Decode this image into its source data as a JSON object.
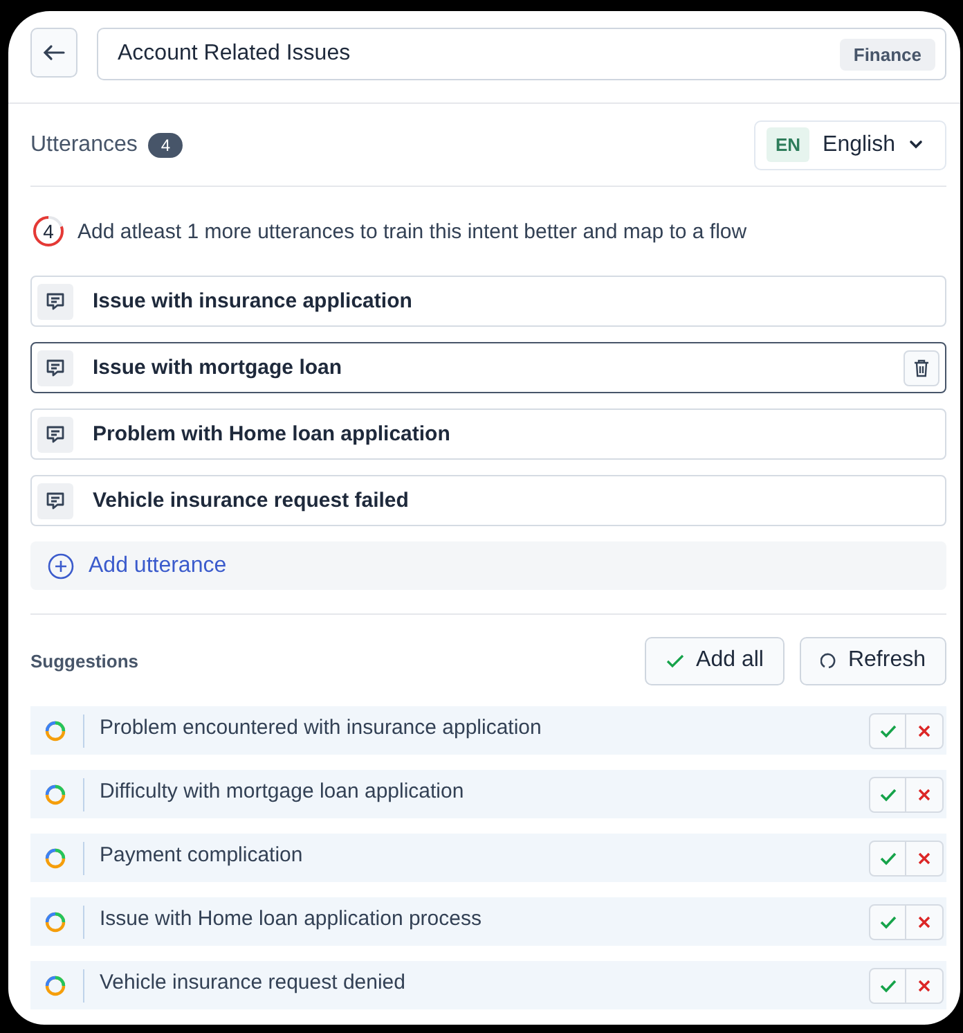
{
  "header": {
    "title": "Account Related Issues",
    "tag": "Finance"
  },
  "utterances_section": {
    "title": "Utterances",
    "count": "4",
    "language": {
      "code": "EN",
      "name": "English"
    }
  },
  "hint": {
    "count": "4",
    "level": 0.8,
    "text": "Add atleast 1 more utterances to train this intent better and map to a flow"
  },
  "utterances": [
    {
      "text": "Issue with insurance application",
      "selected": false
    },
    {
      "text": "Issue with mortgage loan",
      "selected": true
    },
    {
      "text": "Problem with Home loan application",
      "selected": false
    },
    {
      "text": "Vehicle insurance request failed",
      "selected": false
    }
  ],
  "add_utterance": "Add utterance",
  "suggestions": {
    "title": "Suggestions",
    "add_all": "Add all",
    "refresh": "Refresh",
    "items": [
      {
        "text": "Problem encountered with insurance application"
      },
      {
        "text": "Difficulty with mortgage loan application"
      },
      {
        "text": "Payment complication"
      },
      {
        "text": "Issue with Home loan application process"
      },
      {
        "text": "Vehicle insurance request denied"
      }
    ]
  }
}
